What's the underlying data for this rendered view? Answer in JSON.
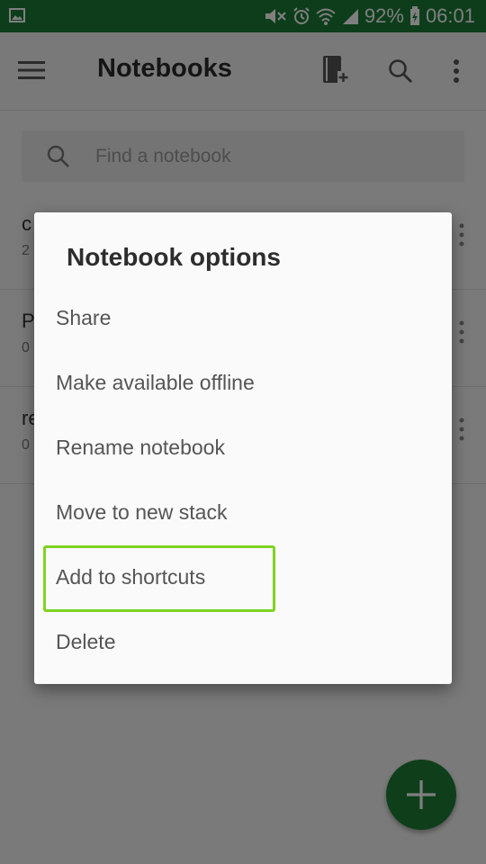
{
  "status_bar": {
    "battery": "92%",
    "time": "06:01"
  },
  "app_bar": {
    "title": "Notebooks"
  },
  "search": {
    "placeholder": "Find a notebook"
  },
  "notebooks": [
    {
      "name": "c",
      "count": "2"
    },
    {
      "name": "P",
      "count": "0"
    },
    {
      "name": "re",
      "count": "0"
    }
  ],
  "dialog": {
    "title": "Notebook options",
    "items": [
      "Share",
      "Make available offline",
      "Rename notebook",
      "Move to new stack",
      "Add to shortcuts",
      "Delete"
    ],
    "highlighted_item": "Add to shortcuts"
  },
  "colors": {
    "status_bar": "#1b7a36",
    "fab": "#1c7f35",
    "highlight": "#7ed321"
  }
}
